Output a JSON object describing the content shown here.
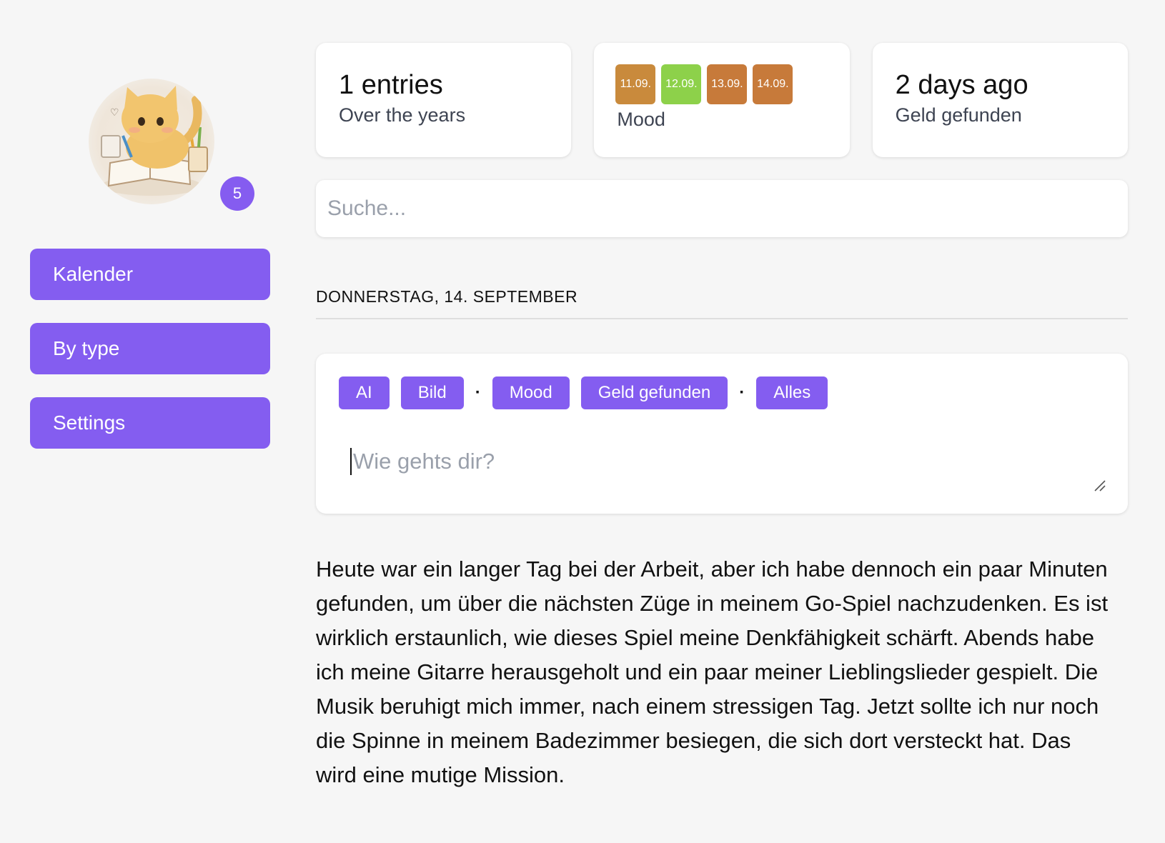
{
  "sidebar": {
    "avatar_alt": "cat writing in book",
    "badge_count": "5",
    "nav": [
      {
        "label": "Kalender"
      },
      {
        "label": "By type"
      },
      {
        "label": "Settings"
      }
    ]
  },
  "stats": {
    "entries": {
      "title": "1 entries",
      "subtitle": "Over the years"
    },
    "mood": {
      "label": "Mood",
      "chips": [
        {
          "date": "11.09.",
          "color": "#c98a3c"
        },
        {
          "date": "12.09.",
          "color": "#8dd14a"
        },
        {
          "date": "13.09.",
          "color": "#c77a3a"
        },
        {
          "date": "14.09.",
          "color": "#c77a3a"
        }
      ]
    },
    "last": {
      "title": "2 days ago",
      "subtitle": "Geld gefunden"
    }
  },
  "search": {
    "placeholder": "Suche..."
  },
  "day": {
    "heading": "DONNERSTAG, 14. SEPTEMBER",
    "tags": {
      "ai": "AI",
      "bild": "Bild",
      "sep": "·",
      "mood": "Mood",
      "geld": "Geld gefunden",
      "alles": "Alles"
    },
    "input_placeholder": "Wie gehts dir?",
    "entry_text": "Heute war ein langer Tag bei der Arbeit, aber ich habe dennoch ein paar Minuten gefunden, um über die nächsten Züge in meinem Go-Spiel nachzudenken. Es ist wirklich erstaunlich, wie dieses Spiel meine Denkfähigkeit schärft. Abends habe ich meine Gitarre herausgeholt und ein paar meiner Lieblingslieder gespielt. Die Musik beruhigt mich immer, nach einem stressigen Tag. Jetzt sollte ich nur noch die Spinne in meinem Badezimmer besiegen, die sich dort versteckt hat. Das wird eine mutige Mission."
  },
  "colors": {
    "accent": "#845df0",
    "background": "#f6f6f6"
  }
}
